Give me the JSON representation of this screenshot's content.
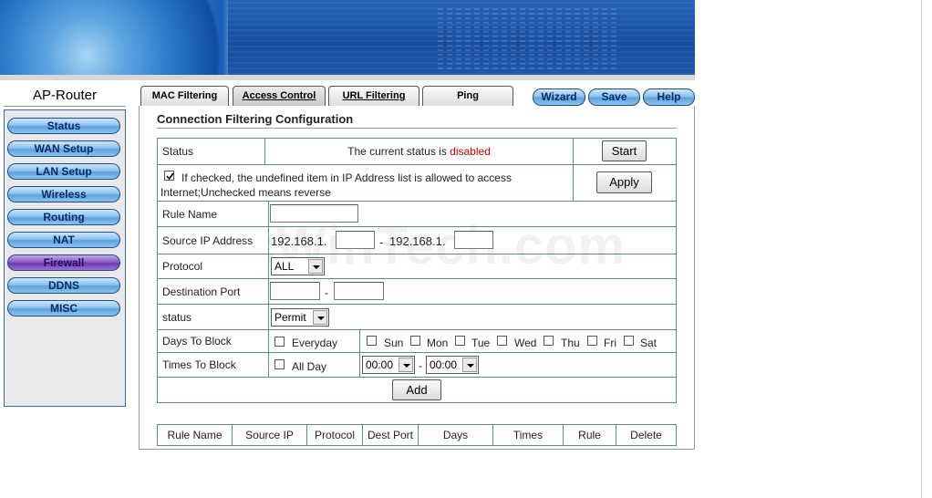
{
  "brand": "AP-Router",
  "nav": [
    {
      "label": "Status"
    },
    {
      "label": "WAN Setup"
    },
    {
      "label": "LAN Setup"
    },
    {
      "label": "Wireless"
    },
    {
      "label": "Routing"
    },
    {
      "label": "NAT"
    },
    {
      "label": "Firewall",
      "active": true
    },
    {
      "label": "DDNS"
    },
    {
      "label": "MISC"
    }
  ],
  "tabs": [
    "MAC Filtering",
    "Access Control",
    "URL Filtering",
    "Ping"
  ],
  "active_tab": "Access Control",
  "top_buttons": {
    "wizard": "Wizard",
    "save": "Save",
    "help": "Help"
  },
  "page_title": "Connection Filtering Configuration",
  "status_row": {
    "label": "Status",
    "text_prefix": "The current status is",
    "state": "disabled",
    "state_color": "#cc0000",
    "button": "Start"
  },
  "undefined_row": {
    "checked": true,
    "text_line1": "If checked, the undefined item in IP Address list is allowed to access",
    "text_line2": "Internet;Unchecked means reverse",
    "button": "Apply"
  },
  "rule_name": {
    "label": "Rule Name",
    "value": ""
  },
  "source_ip": {
    "label": "Source IP Address",
    "prefix_from": "192.168.1.",
    "from_value": "",
    "dash": "-",
    "prefix_to": "192.168.1.",
    "to_value": ""
  },
  "protocol": {
    "label": "Protocol",
    "selected": "ALL"
  },
  "dest_port": {
    "label": "Destination Port",
    "from": "",
    "dash": "-",
    "to": ""
  },
  "status_select": {
    "label": "status",
    "selected": "Permit"
  },
  "days": {
    "label": "Days To Block",
    "everyday": "Everyday",
    "list": [
      "Sun",
      "Mon",
      "Tue",
      "Wed",
      "Thu",
      "Fri",
      "Sat"
    ]
  },
  "times": {
    "label": "Times To Block",
    "allday": "All Day",
    "from": "00:00",
    "dash": "-",
    "to": "00:00"
  },
  "add_button": "Add",
  "table_headers": [
    "Rule Name",
    "Source IP",
    "Protocol",
    "Dest Port",
    "Days",
    "Times",
    "Rule",
    "Delete"
  ],
  "watermark": "PcWinTech.com"
}
